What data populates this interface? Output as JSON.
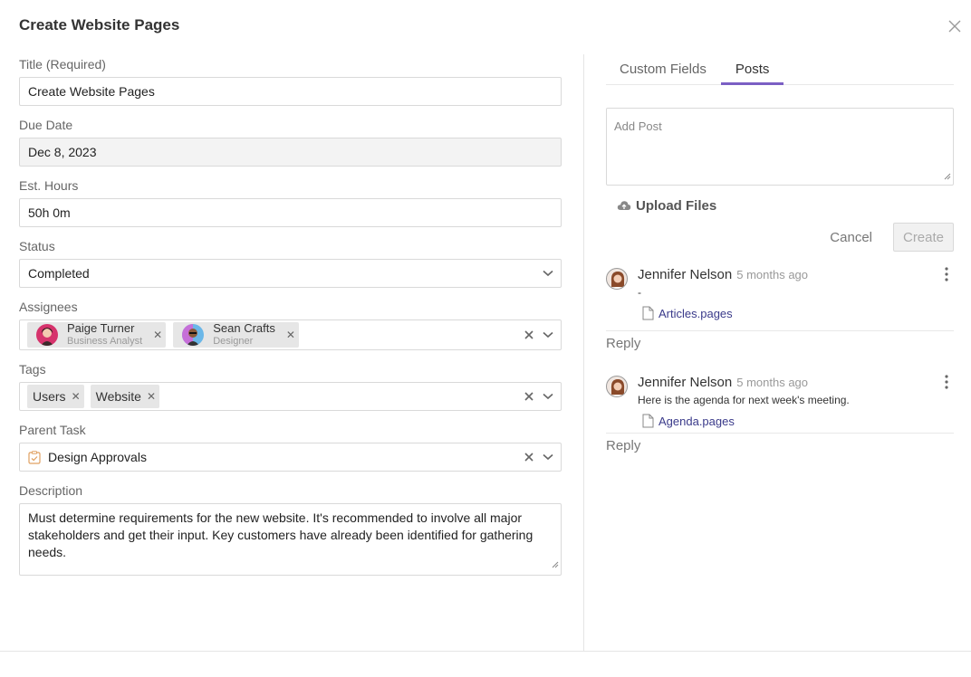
{
  "dialog": {
    "title": "Create Website Pages"
  },
  "form": {
    "title": {
      "label": "Title (Required)",
      "value": "Create Website Pages"
    },
    "due_date": {
      "label": "Due Date",
      "value": "Dec 8, 2023"
    },
    "est_hours": {
      "label": "Est. Hours",
      "value": "50h 0m"
    },
    "status": {
      "label": "Status",
      "value": "Completed"
    },
    "assignees": {
      "label": "Assignees",
      "items": [
        {
          "name": "Paige Turner",
          "role": "Business Analyst"
        },
        {
          "name": "Sean Crafts",
          "role": "Designer"
        }
      ]
    },
    "tags": {
      "label": "Tags",
      "items": [
        "Users",
        "Website"
      ]
    },
    "parent_task": {
      "label": "Parent Task",
      "value": "Design Approvals"
    },
    "description": {
      "label": "Description",
      "value": "Must determine requirements for the new website. It's recommended to involve all major stakeholders and get their input. Key customers have already been identified for gathering needs."
    }
  },
  "panel": {
    "tabs": [
      {
        "label": "Custom Fields",
        "active": false
      },
      {
        "label": "Posts",
        "active": true
      }
    ],
    "post_input": {
      "placeholder": "Add Post"
    },
    "upload_label": "Upload Files",
    "cancel_label": "Cancel",
    "create_label": "Create",
    "posts": [
      {
        "author": "Jennifer Nelson",
        "time": "5 months ago",
        "body": "-",
        "file": "Articles.pages",
        "reply": "Reply"
      },
      {
        "author": "Jennifer Nelson",
        "time": "5 months ago",
        "body": "Here is the agenda for next week's meeting.",
        "file": "Agenda.pages",
        "reply": "Reply"
      }
    ]
  },
  "colors": {
    "accent": "#7b5fc4",
    "link": "#3a3a8a"
  }
}
